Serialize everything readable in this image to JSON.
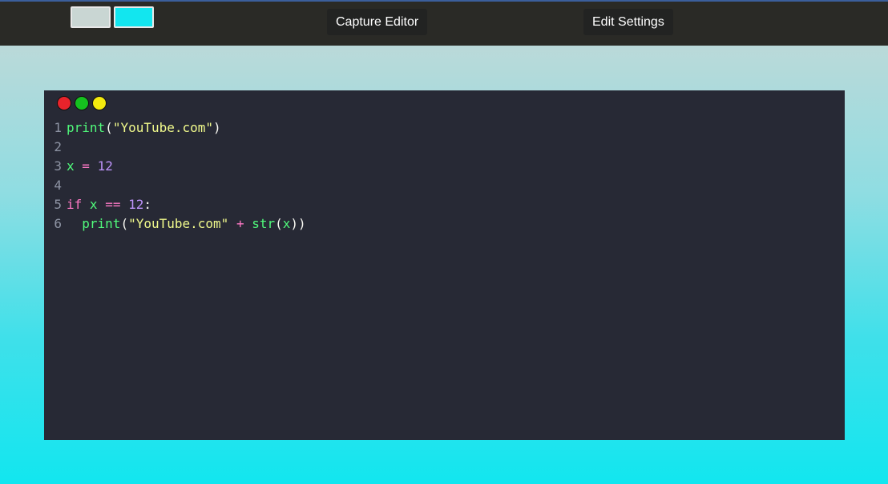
{
  "colors": {
    "swatch_1": "#c9d6d3",
    "swatch_2": "#12e6ef",
    "topbar": "#2a2a26",
    "editor_bg": "#272935"
  },
  "toolbar": {
    "capture_label": "Capture Editor",
    "settings_label": "Edit Settings"
  },
  "editor": {
    "window_controls": [
      "close-dot",
      "maximize-dot",
      "minimize-dot"
    ],
    "lines": [
      {
        "number": "1",
        "tokens": [
          {
            "cls": "fn",
            "text": "print"
          },
          {
            "cls": "",
            "text": "("
          },
          {
            "cls": "str",
            "text": "\"YouTube.com\""
          },
          {
            "cls": "",
            "text": ")"
          }
        ]
      },
      {
        "number": "2",
        "tokens": []
      },
      {
        "number": "3",
        "tokens": [
          {
            "cls": "var",
            "text": "x"
          },
          {
            "cls": "",
            "text": " "
          },
          {
            "cls": "op",
            "text": "="
          },
          {
            "cls": "",
            "text": " "
          },
          {
            "cls": "num",
            "text": "12"
          }
        ]
      },
      {
        "number": "4",
        "tokens": []
      },
      {
        "number": "5",
        "tokens": [
          {
            "cls": "kw",
            "text": "if"
          },
          {
            "cls": "",
            "text": " "
          },
          {
            "cls": "var",
            "text": "x"
          },
          {
            "cls": "",
            "text": " "
          },
          {
            "cls": "op",
            "text": "=="
          },
          {
            "cls": "",
            "text": " "
          },
          {
            "cls": "num",
            "text": "12"
          },
          {
            "cls": "",
            "text": ":"
          }
        ]
      },
      {
        "number": "6",
        "tokens": [
          {
            "cls": "",
            "text": "  "
          },
          {
            "cls": "fn",
            "text": "print"
          },
          {
            "cls": "",
            "text": "("
          },
          {
            "cls": "str",
            "text": "\"YouTube.com\""
          },
          {
            "cls": "",
            "text": " "
          },
          {
            "cls": "op",
            "text": "+"
          },
          {
            "cls": "",
            "text": " "
          },
          {
            "cls": "fn",
            "text": "str"
          },
          {
            "cls": "",
            "text": "("
          },
          {
            "cls": "var",
            "text": "x"
          },
          {
            "cls": "",
            "text": "))"
          }
        ]
      }
    ]
  }
}
